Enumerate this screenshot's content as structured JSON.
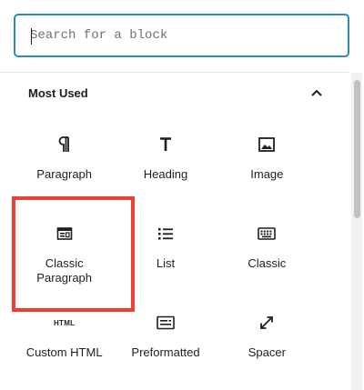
{
  "search": {
    "placeholder": "Search for a block",
    "value": ""
  },
  "panel": {
    "title": "Most Used",
    "toggle_icon": "chevron-up-icon",
    "expanded": true
  },
  "blocks": [
    {
      "label": "Paragraph",
      "icon": "paragraph-icon"
    },
    {
      "label": "Heading",
      "icon": "heading-icon"
    },
    {
      "label": "Image",
      "icon": "image-icon"
    },
    {
      "label": "Classic Paragraph",
      "icon": "classic-paragraph-icon",
      "highlighted": true
    },
    {
      "label": "List",
      "icon": "list-icon"
    },
    {
      "label": "Classic",
      "icon": "keyboard-icon"
    },
    {
      "label": "Custom HTML",
      "icon": "html-icon",
      "icon_text": "HTML"
    },
    {
      "label": "Preformatted",
      "icon": "preformatted-icon"
    },
    {
      "label": "Spacer",
      "icon": "spacer-icon"
    }
  ],
  "colors": {
    "search_border": "#2e8ea7",
    "highlight": "#ef3f33",
    "text": "#1e1e1e"
  }
}
